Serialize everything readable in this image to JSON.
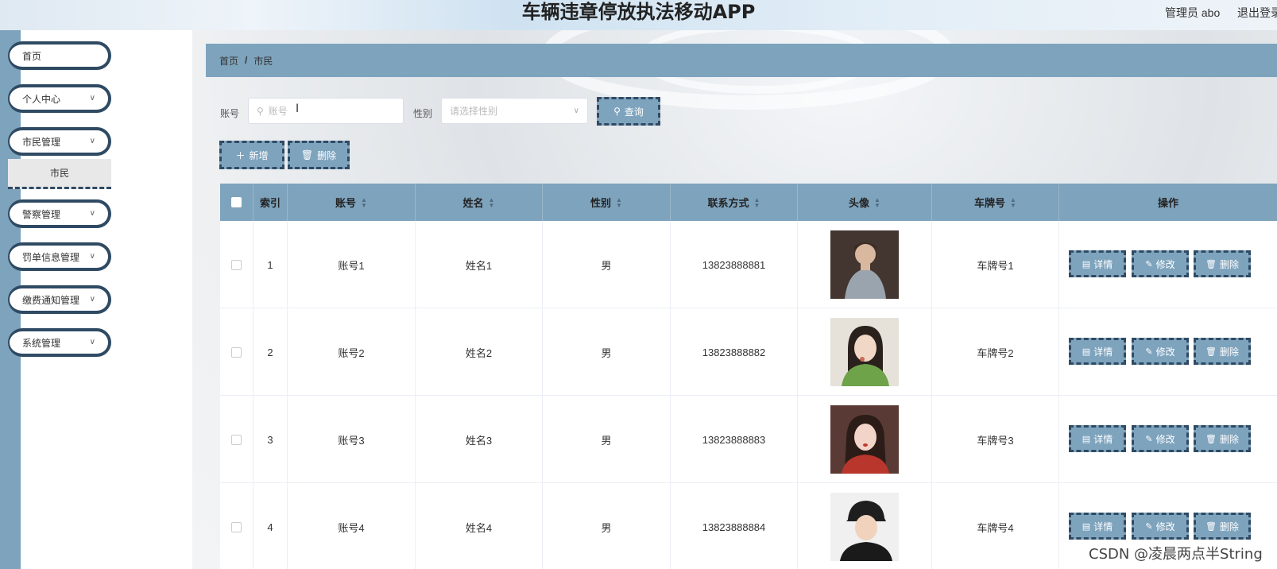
{
  "header": {
    "title": "车辆违章停放执法移动APP",
    "admin": "管理员 abo",
    "logout": "退出登录"
  },
  "sidebar": {
    "items": [
      {
        "label": "首页",
        "has_chevron": false
      },
      {
        "label": "个人中心",
        "has_chevron": true
      },
      {
        "label": "市民管理",
        "has_chevron": true
      },
      {
        "label": "警察管理",
        "has_chevron": true
      },
      {
        "label": "罚单信息管理",
        "has_chevron": true
      },
      {
        "label": "缴费通知管理",
        "has_chevron": true
      },
      {
        "label": "系统管理",
        "has_chevron": true
      }
    ],
    "active_sub": "市民"
  },
  "breadcrumb": {
    "home": "首页",
    "sep": "/",
    "current": "市民"
  },
  "search": {
    "account_label": "账号",
    "account_placeholder": "账号",
    "gender_label": "性别",
    "gender_placeholder": "请选择性别",
    "search_button": "查询"
  },
  "actions": {
    "add": "新增",
    "delete": "删除"
  },
  "table": {
    "headers": {
      "index": "索引",
      "account": "账号",
      "name": "姓名",
      "gender": "性别",
      "phone": "联系方式",
      "avatar": "头像",
      "plate": "车牌号",
      "ops": "操作"
    },
    "rows": [
      {
        "index": "1",
        "account": "账号1",
        "name": "姓名1",
        "gender": "男",
        "phone": "13823888881",
        "plate": "车牌号1"
      },
      {
        "index": "2",
        "account": "账号2",
        "name": "姓名2",
        "gender": "男",
        "phone": "13823888882",
        "plate": "车牌号2"
      },
      {
        "index": "3",
        "account": "账号3",
        "name": "姓名3",
        "gender": "男",
        "phone": "13823888883",
        "plate": "车牌号3"
      },
      {
        "index": "4",
        "account": "账号4",
        "name": "姓名4",
        "gender": "男",
        "phone": "13823888884",
        "plate": "车牌号4"
      }
    ],
    "row_buttons": {
      "detail": "详情",
      "edit": "修改",
      "delete": "删除"
    }
  },
  "watermark": "CSDN @凌晨两点半String",
  "colors": {
    "accent": "#7ea3bd",
    "border_dark": "#2f4a63"
  }
}
